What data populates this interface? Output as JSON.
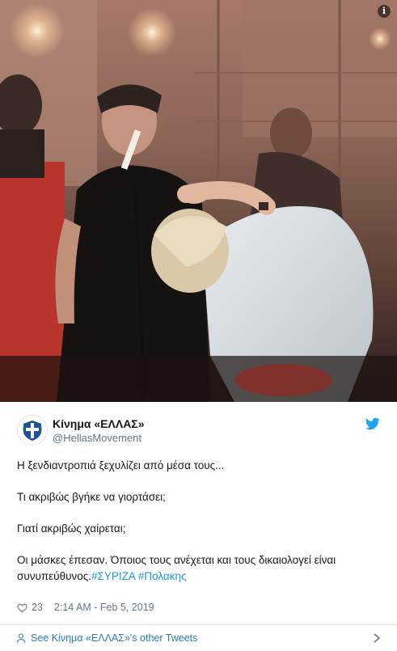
{
  "media": {
    "description_icon": "info-icon",
    "info_label": "i"
  },
  "author": {
    "name": "Κίνημα «ΕΛΛΑΣ»",
    "handle": "@HellasMovement",
    "avatar_icon": "greek-flag-emblem-icon"
  },
  "brand_icon": "twitter-bird-icon",
  "tweet": {
    "line1": "Η ξενδιαντροπιά ξεχυλίζει από μέσα τους...",
    "line2": "Τι ακριβώς βγήκε να γιορτάσει;",
    "line3": "Γιατί ακριβώς χαίρεται;",
    "line4_a": "Οι μάσκες έπεσαν. Όποιος τους ανέχεται και τους δικαιολογεί είναι συνυπεύθυνος.",
    "hashtag1": "#ΣΥΡΙΖΑ",
    "hashtag2": "#Πολακης"
  },
  "meta": {
    "like_count": "23",
    "timestamp": "2:14 AM - Feb 5, 2019"
  },
  "footer": {
    "label": "See Κίνημα «ΕΛΛΑΣ»'s other Tweets"
  },
  "colors": {
    "link": "#1b95e0",
    "muted": "#657786",
    "twitter_blue": "#1da1f2"
  }
}
